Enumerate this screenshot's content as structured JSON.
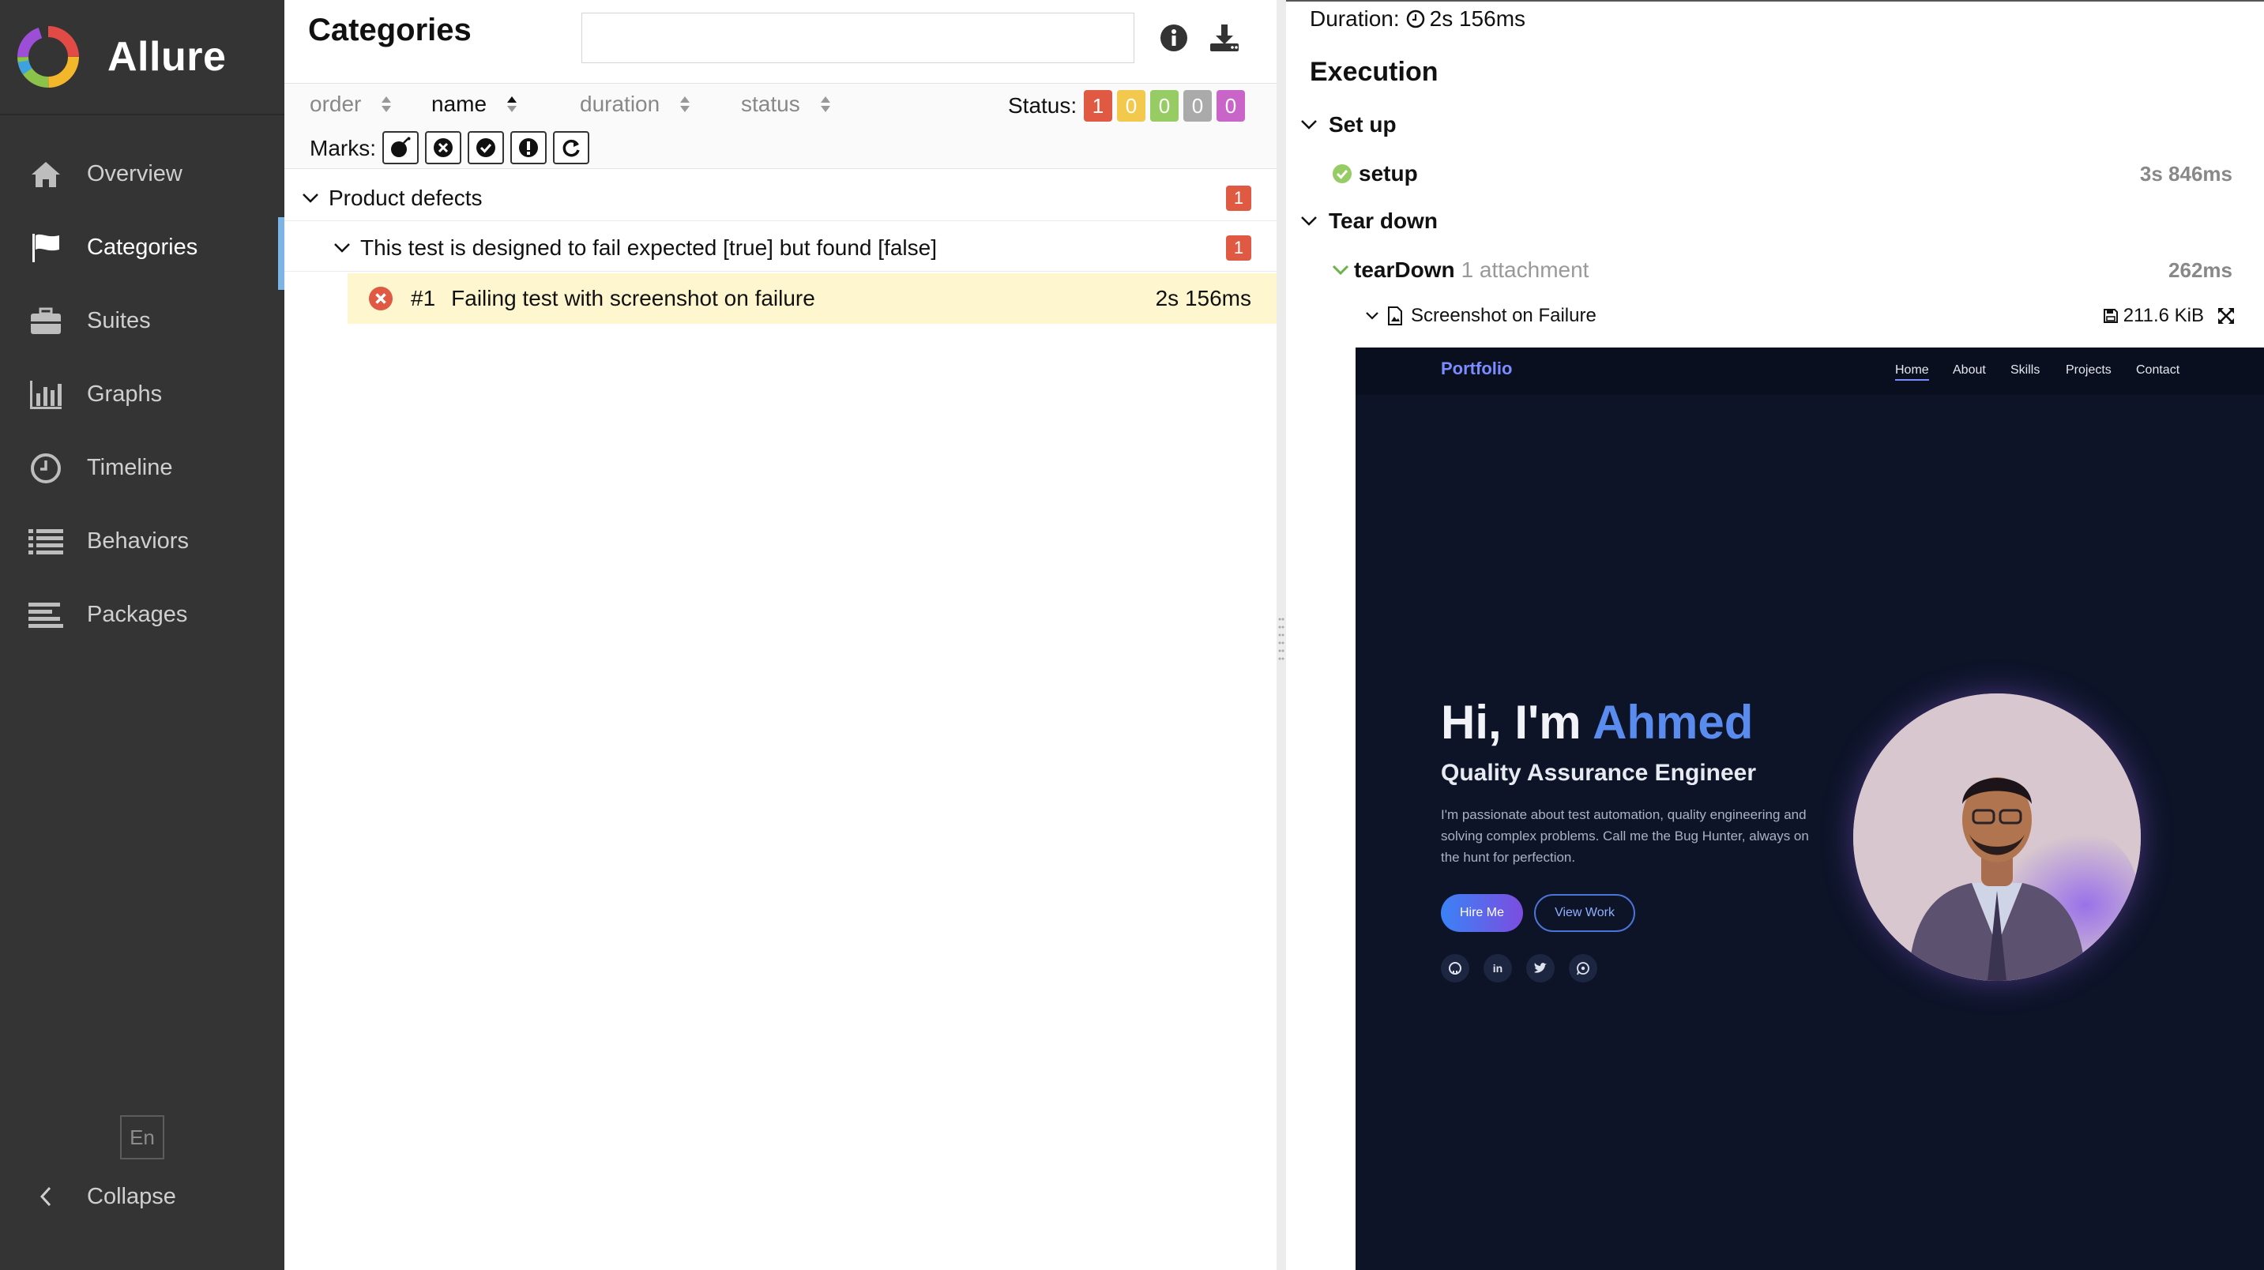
{
  "app": {
    "name": "Allure"
  },
  "sidebar": {
    "items": [
      {
        "label": "Overview",
        "icon": "home-icon"
      },
      {
        "label": "Categories",
        "icon": "flag-icon",
        "active": true
      },
      {
        "label": "Suites",
        "icon": "briefcase-icon"
      },
      {
        "label": "Graphs",
        "icon": "bar-chart-icon"
      },
      {
        "label": "Timeline",
        "icon": "clock-icon"
      },
      {
        "label": "Behaviors",
        "icon": "list-icon"
      },
      {
        "label": "Packages",
        "icon": "align-left-icon"
      }
    ],
    "language": "En",
    "collapse_label": "Collapse"
  },
  "center": {
    "title": "Categories",
    "search": {
      "value": "",
      "placeholder": ""
    },
    "sort": {
      "order": "order",
      "name": "name",
      "duration": "duration",
      "status": "status"
    },
    "status_label": "Status:",
    "status_counts": [
      {
        "value": "1",
        "color": "#e05a43"
      },
      {
        "value": "0",
        "color": "#f2c94c"
      },
      {
        "value": "0",
        "color": "#97cc64"
      },
      {
        "value": "0",
        "color": "#aaaaaa"
      },
      {
        "value": "0",
        "color": "#c964c9"
      }
    ],
    "marks_label": "Marks:",
    "marks": [
      "flaky-bomb-icon",
      "new-failed-icon",
      "new-passed-icon",
      "new-broken-icon",
      "retries-icon"
    ],
    "category": {
      "name": "Product defects",
      "count": "1"
    },
    "message": {
      "text": "This test is designed to fail expected [true] but found [false]",
      "count": "1"
    },
    "test": {
      "order": "#1",
      "name": "Failing test with screenshot on failure",
      "duration": "2s 156ms",
      "status": "failed"
    }
  },
  "detail": {
    "duration_label": "Duration:",
    "duration_value": "2s 156ms",
    "execution_title": "Execution",
    "setup_section": "Set up",
    "setup_step": {
      "name": "setup",
      "time": "3s 846ms"
    },
    "teardown_section": "Tear down",
    "teardown_step": {
      "name": "tearDown",
      "attachments": "1 attachment",
      "time": "262ms"
    },
    "attachment": {
      "name": "Screenshot on Failure",
      "size": "211.6 KiB"
    }
  },
  "screenshot": {
    "logo": "Portfolio",
    "nav": [
      "Home",
      "About",
      "Skills",
      "Projects",
      "Contact"
    ],
    "greeting": "Hi, I'm ",
    "name": "Ahmed",
    "role": "Quality Assurance Engineer",
    "bio": "I'm passionate about test automation, quality engineering and solving complex problems. Call me the Bug Hunter, always on the hunt for perfection.",
    "hire_label": "Hire Me",
    "view_label": "View Work",
    "socials": [
      "github-icon",
      "linkedin-icon",
      "twitter-icon",
      "whatsapp-icon"
    ]
  }
}
